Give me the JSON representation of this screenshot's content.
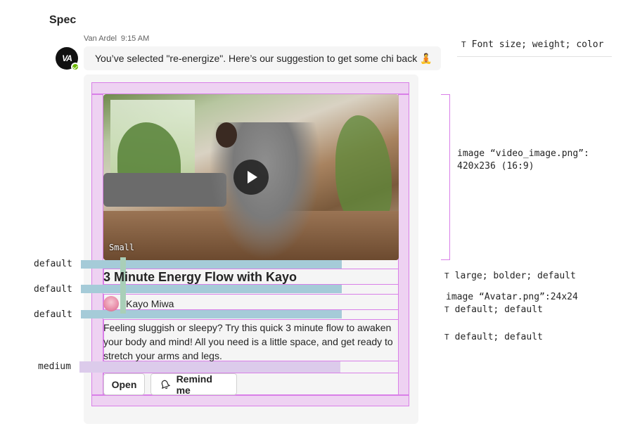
{
  "spec_title": "Spec",
  "message": {
    "sender": "Van Ardel",
    "time": "9:15 AM",
    "avatar_initials": "VA",
    "text": "You’ve selected \"re-energize\".  Here’s our suggestion to get some chi back 🧘"
  },
  "card": {
    "video_tag": "Small",
    "title": "3 Minute Energy Flow with Kayo",
    "author": "Kayo Miwa",
    "description": "Feeling sluggish or sleepy? Try this quick 3 minute flow to awaken your body and mind! All you need is a little space, and get ready to stretch your arms and legs.",
    "buttons": {
      "open": "Open",
      "remind": "Remind me"
    }
  },
  "left_labels": {
    "l1": "default",
    "l2": "default",
    "l3": "default",
    "l4": "medium"
  },
  "right_specs": {
    "font": "Font size; weight; color",
    "image_video": "image “video_image.png”:\n420x236 (16:9)",
    "title": "large; bolder; default",
    "image_avatar": "image “Avatar.png”:24x24",
    "author": "default; default",
    "desc": "default; default"
  },
  "colors": {
    "spacing_blue": "#a5cbd8",
    "padding_pink": "#d97fe8",
    "padding_purple": "#dccbeb",
    "status_green": "#6bb700"
  }
}
